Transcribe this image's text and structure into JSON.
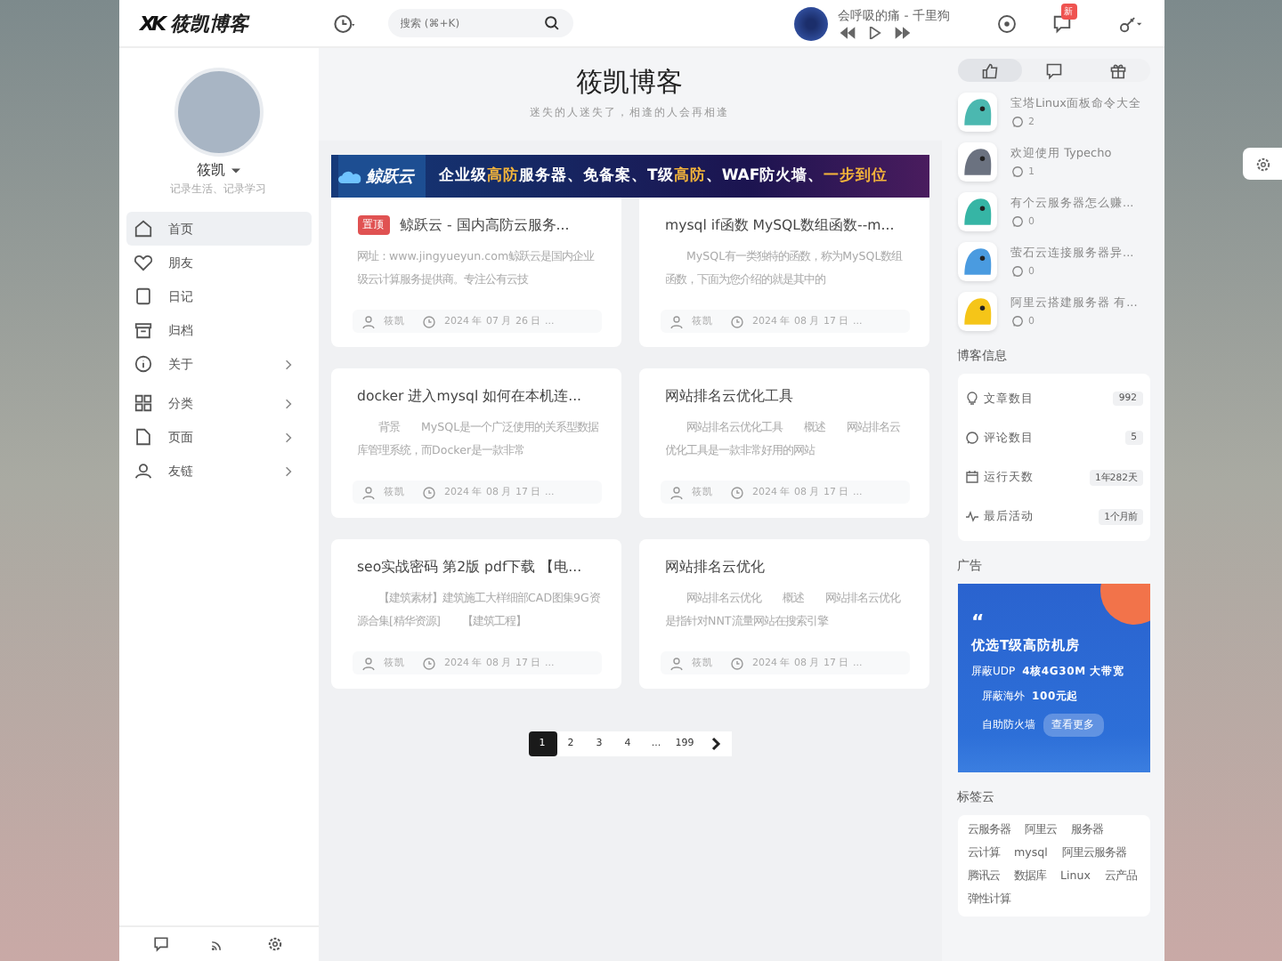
{
  "header": {
    "logo_mark": "XK",
    "logo": "筱凯博客",
    "search": {
      "placeholder": "搜索 (⌘+K)"
    },
    "music": {
      "title": "会呼吸的痛 - 千里狗"
    },
    "notification_badge": "新"
  },
  "profile": {
    "name": "筱凯",
    "motto": "记录生活、记录学习"
  },
  "nav": [
    {
      "label": "首页",
      "kind": "home",
      "selected": true,
      "expandable": false
    },
    {
      "label": "朋友",
      "kind": "heart",
      "selected": false,
      "expandable": false
    },
    {
      "label": "日记",
      "kind": "book",
      "selected": false,
      "expandable": false
    },
    {
      "label": "归档",
      "kind": "archive",
      "selected": false,
      "expandable": false
    },
    {
      "label": "关于",
      "kind": "info",
      "selected": false,
      "expandable": true
    },
    {
      "label": "分类",
      "kind": "grid",
      "selected": false,
      "expandable": true
    },
    {
      "label": "页面",
      "kind": "page",
      "selected": false,
      "expandable": true
    },
    {
      "label": "友链",
      "kind": "user",
      "selected": false,
      "expandable": true
    }
  ],
  "site": {
    "title": "筱凯博客",
    "subtitle": "迷失的人迷失了，相逢的人会再相逢"
  },
  "banner": {
    "brand": "鲸跃云",
    "segments": [
      {
        "text": "企业级",
        "highlight": false
      },
      {
        "text": "高防",
        "highlight": true
      },
      {
        "text": "服务器、免备案、T级",
        "highlight": false
      },
      {
        "text": "高防",
        "highlight": true
      },
      {
        "text": "、WAF防火墙、",
        "highlight": false
      },
      {
        "text": "一步到位",
        "highlight": true
      }
    ]
  },
  "posts": [
    {
      "pinned": true,
      "badge": "置顶",
      "title": "鲸跃云 - 国内高防云服务...",
      "excerpt": "网址：www.jingyueyun.com鲸跃云是国内企业级云计算服务提供商。专注公有云技",
      "author": "筱凯",
      "date": "2024 年 07 月 26 日 ..."
    },
    {
      "pinned": false,
      "title": "mysql if函数 MySQL数组函数--m...",
      "excerpt": "　　MySQL有一类独特的函数，称为MySQL数组函数，下面为您介绍的就是其中的",
      "author": "筱凯",
      "date": "2024 年 08 月 17 日 ..."
    },
    {
      "pinned": false,
      "title": "docker 进入mysql 如何在本机连...",
      "excerpt": "　　背景　　MySQL是一个广泛使用的关系型数据库管理系统，而Docker是一款非常",
      "author": "筱凯",
      "date": "2024 年 08 月 17 日 ..."
    },
    {
      "pinned": false,
      "title": "网站排名云优化工具",
      "excerpt": "　　网站排名云优化工具　　概述　　网站排名云优化工具是一款非常好用的网站",
      "author": "筱凯",
      "date": "2024 年 08 月 17 日 ..."
    },
    {
      "pinned": false,
      "title": "seo实战密码 第2版 pdf下载 【电...",
      "excerpt": "　　【建筑素材】建筑施工大样细部CAD图集9G资源合集[精华资源]　　【建筑工程】",
      "author": "筱凯",
      "date": "2024 年 08 月 17 日 ..."
    },
    {
      "pinned": false,
      "title": "网站排名云优化",
      "excerpt": "　　网站排名云优化　　概述　　网站排名云优化是指针对NNT流量网站在搜索引擎",
      "author": "筱凯",
      "date": "2024 年 08 月 17 日 ..."
    }
  ],
  "pagination": [
    {
      "label": "1",
      "selected": true
    },
    {
      "label": "2",
      "selected": false
    },
    {
      "label": "3",
      "selected": false
    },
    {
      "label": "4",
      "selected": false
    },
    {
      "label": "...",
      "selected": false
    },
    {
      "label": "199",
      "selected": false
    }
  ],
  "right_tabs": [
    {
      "kind": "thumb",
      "selected": true
    },
    {
      "kind": "comment",
      "selected": false
    },
    {
      "kind": "gift",
      "selected": false
    }
  ],
  "hot_posts": [
    {
      "title": "宝塔Linux面板命令大全",
      "comments": "2",
      "color": "#4bb8b0"
    },
    {
      "title": "欢迎使用 Typecho",
      "comments": "1",
      "color": "#6b7280"
    },
    {
      "title": "有个云服务器怎么赚...",
      "comments": "0",
      "color": "#36b5a5"
    },
    {
      "title": "萤石云连接服务器异...",
      "comments": "0",
      "color": "#4a9be0"
    },
    {
      "title": "阿里云搭建服务器 有...",
      "comments": "0",
      "color": "#f5c518"
    }
  ],
  "blog_info": {
    "title": "博客信息",
    "rows": [
      {
        "kind": "bulb",
        "label": "文章数目",
        "value": "992"
      },
      {
        "kind": "comment",
        "label": "评论数目",
        "value": "5"
      },
      {
        "kind": "calendar",
        "label": "运行天数",
        "value": "1年282天"
      },
      {
        "kind": "pulse",
        "label": "最后活动",
        "value": "1个月前"
      }
    ]
  },
  "ad": {
    "title": "广告",
    "quote": "“",
    "headline": "优选T级高防机房",
    "spec": "4核4G30M 大带宽",
    "feature_1": "屏蔽UDP",
    "feature_2": "屏蔽海外",
    "price": "100元起",
    "feature_3": "自助防火墙",
    "button": "查看更多"
  },
  "tags": {
    "title": "标签云",
    "items": [
      "云服务器",
      "阿里云",
      "服务器",
      "云计算",
      "mysql",
      "阿里云服务器",
      "腾讯云",
      "数据库",
      "Linux",
      "云产品",
      "弹性计算"
    ]
  }
}
